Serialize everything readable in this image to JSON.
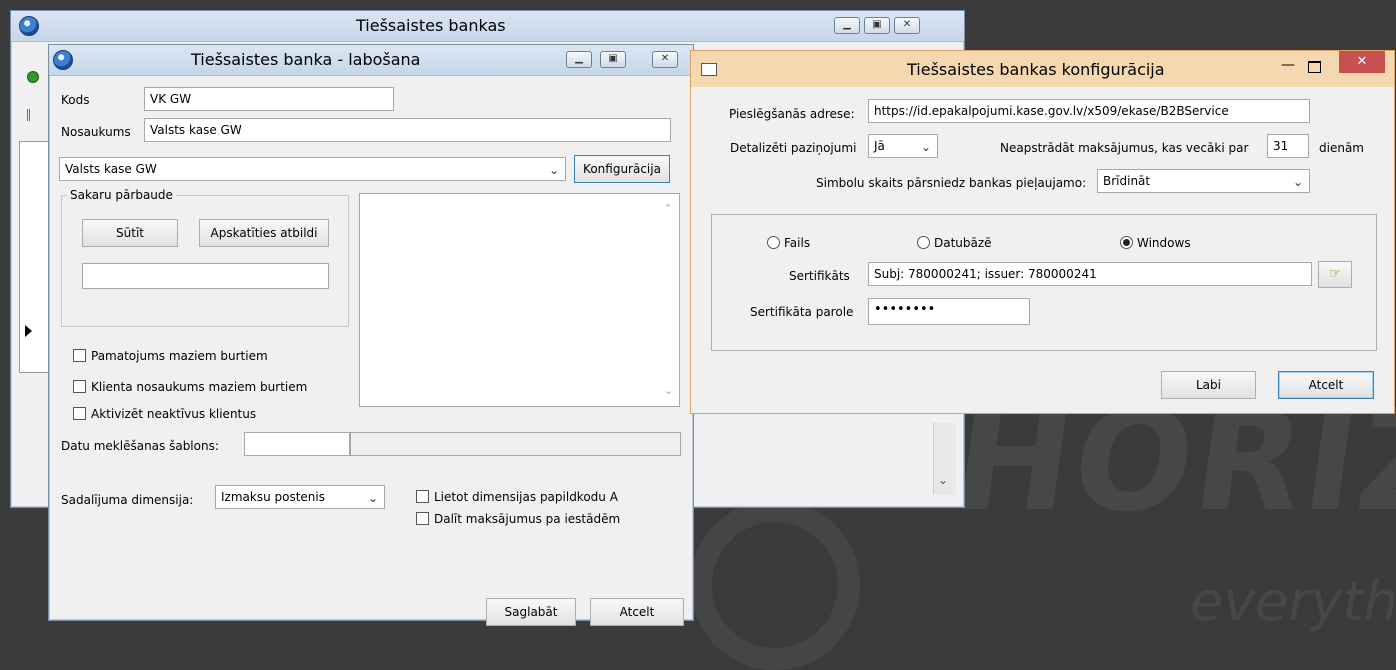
{
  "main_window": {
    "title": "Tiešsaistes bankas"
  },
  "edit_window": {
    "title": "Tiešsaistes banka - labošana",
    "kods_label": "Kods",
    "kods_value": "VK GW",
    "nosaukums_label": "Nosaukums",
    "nosaukums_value": "Valsts kase GW",
    "bank_select": "Valsts kase GW",
    "config_button": "Konfigurācija",
    "group_title": "Sakaru pārbaude",
    "send_button": "Sūtīt",
    "view_response_button": "Apskatīties atbildi",
    "checkboxes": [
      "Pamatojums maziem burtiem",
      "Klienta nosaukums maziem burtiem",
      "Aktivizēt neaktīvus klientus"
    ],
    "template_label": "Datu meklēšanas šablons:",
    "dimension_label": "Sadalījuma dimensija:",
    "dimension_value": "Izmaksu postenis",
    "dim_checkboxes": [
      "Lietot dimensijas papildkodu A",
      "Dalīt maksājumus pa iestādēm"
    ],
    "save_button": "Saglabāt",
    "cancel_button": "Atcelt"
  },
  "config_window": {
    "title": "Tiešsaistes bankas konfigurācija",
    "address_label": "Pieslēgšanās adrese:",
    "address_value": "https://id.epakalpojumi.kase.gov.lv/x509/ekase/B2BService",
    "detailed_label": "Detalizēti paziņojumi",
    "detailed_value": "Jā",
    "older_label": "Neapstrādāt maksājumus, kas vecāki par",
    "older_value": "31",
    "days_label": "dienām",
    "symbols_label": "Simbolu skaits pārsniedz bankas pieļaujamo:",
    "symbols_value": "Brīdināt",
    "radio_file": "Fails",
    "radio_db": "Datubāzē",
    "radio_windows": "Windows",
    "cert_label": "Sertifikāts",
    "cert_value": "Subj: 780000241; issuer: 780000241",
    "pass_label": "Sertifikāta parole",
    "pass_value": "••••••••",
    "ok_button": "Labi",
    "cancel_button": "Atcelt"
  },
  "background": {
    "logo_text": "HORIZO",
    "tagline": "everyth"
  }
}
